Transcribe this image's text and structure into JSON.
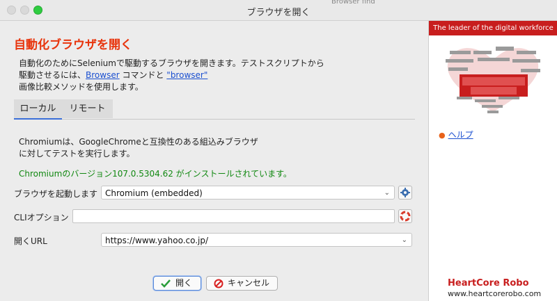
{
  "window": {
    "title": "ブラウザを開く",
    "bg_peek": "Browser find"
  },
  "dialog": {
    "heading": "自動化ブラウザを開く",
    "desc_line1": "自動化のためにSeleniumで駆動するブラウザを開きます。テストスクリプトから",
    "desc_line2_pre": "駆動させるには、",
    "desc_link1": "Browser",
    "desc_line2_mid": " コマンドと ",
    "desc_link2": "\"browser\"",
    "desc_line3": "画像比較メソッドを使用します。",
    "tabs": [
      {
        "label": "ローカル"
      },
      {
        "label": "リモート"
      }
    ],
    "info_line1": "Chromiumは、GoogleChromeと互換性のある組込みブラウザ",
    "info_line2": "に対してテストを実行します。",
    "installed": "Chromiumのバージョン107.0.5304.62 がインストールされています。",
    "launch_label": "ブラウザを起動します",
    "launch_value": "Chromium (embedded)",
    "cli_label": "CLIオプション",
    "cli_value": "",
    "url_label": "開くURL",
    "url_value": "https://www.yahoo.co.jp/",
    "ok_label": "開く",
    "cancel_label": "キャンセル"
  },
  "sidebar": {
    "banner_title": "The leader of the digital workforce",
    "help_label": "ヘルプ",
    "footer_logo": "HeartCore Robo",
    "footer_url": "www.heartcorerobo.com"
  },
  "colors": {
    "accent": "#e8340c",
    "brand": "#c81e1e",
    "link": "#1a4fd0",
    "success": "#118811"
  }
}
